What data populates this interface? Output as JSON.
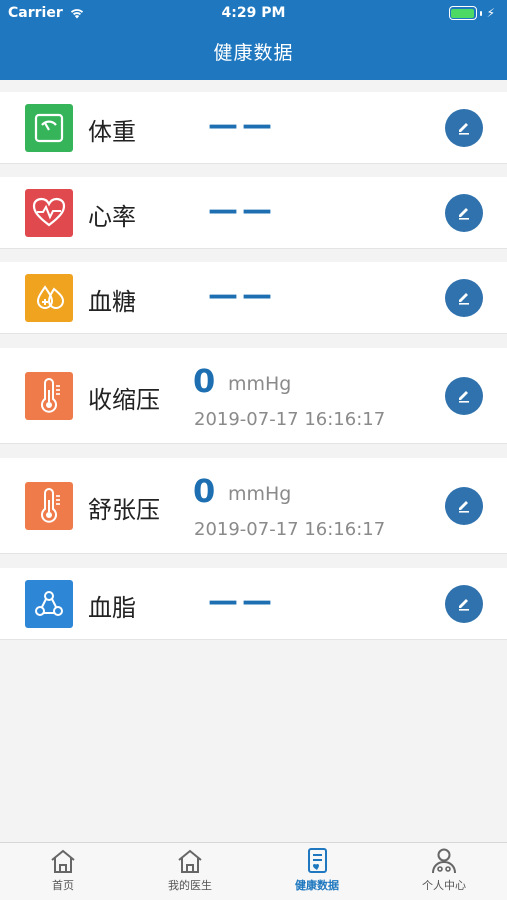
{
  "status_bar": {
    "carrier": "Carrier",
    "time": "4:29 PM"
  },
  "nav": {
    "title": "健康数据"
  },
  "items": [
    {
      "label": "体重",
      "value_text": "——",
      "icon": "scale-icon",
      "color": "#35b45a"
    },
    {
      "label": "心率",
      "value_text": "——",
      "icon": "heart-rate-icon",
      "color": "#e04a4f"
    },
    {
      "label": "血糖",
      "value_text": "——",
      "icon": "blood-drop-icon",
      "color": "#f0a31f"
    },
    {
      "label": "收缩压",
      "value": "0",
      "unit": "mmHg",
      "timestamp": "2019-07-17 16:16:17",
      "icon": "thermometer-icon",
      "color": "#f07b4a"
    },
    {
      "label": "舒张压",
      "value": "0",
      "unit": "mmHg",
      "timestamp": "2019-07-17 16:16:17",
      "icon": "thermometer-icon",
      "color": "#f07b4a"
    },
    {
      "label": "血脂",
      "value_text": "——",
      "icon": "lipid-icon",
      "color": "#2e86d6"
    }
  ],
  "tabs": [
    {
      "label": "首页",
      "icon": "home-icon",
      "active": false
    },
    {
      "label": "我的医生",
      "icon": "home-icon",
      "active": false
    },
    {
      "label": "健康数据",
      "icon": "document-icon",
      "active": true
    },
    {
      "label": "个人中心",
      "icon": "person-icon",
      "active": false
    }
  ],
  "colors": {
    "primary": "#1f78bf",
    "accent_value": "#1d6fb1",
    "edit_button": "#2f72ad"
  }
}
